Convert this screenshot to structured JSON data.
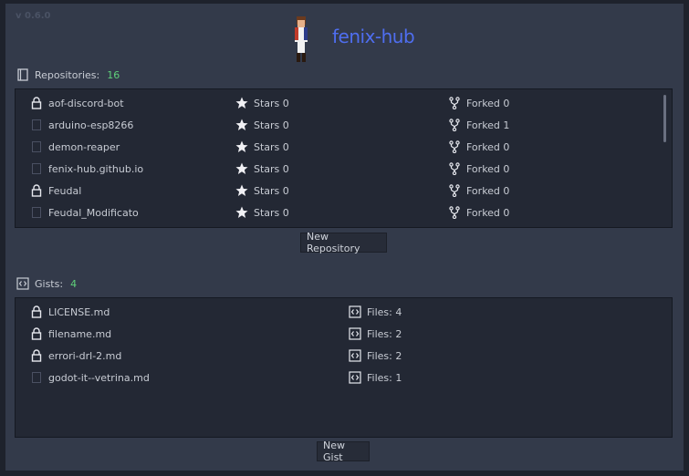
{
  "app": {
    "version": "v 0.6.0",
    "title": "fenix-hub"
  },
  "repositories": {
    "label": "Repositories:",
    "count": "16",
    "items": [
      {
        "name": "aof-discord-bot",
        "icon": "lock-icon",
        "stars": "Stars 0",
        "forks": "Forked 0"
      },
      {
        "name": "arduino-esp8266",
        "icon": "repo-icon",
        "stars": "Stars 0",
        "forks": "Forked 1"
      },
      {
        "name": "demon-reaper",
        "icon": "repo-icon",
        "stars": "Stars 0",
        "forks": "Forked 0"
      },
      {
        "name": "fenix-hub.github.io",
        "icon": "repo-icon",
        "stars": "Stars 0",
        "forks": "Forked 0"
      },
      {
        "name": "Feudal",
        "icon": "lock-icon",
        "stars": "Stars 0",
        "forks": "Forked 0"
      },
      {
        "name": "Feudal_Modificato",
        "icon": "repo-icon",
        "stars": "Stars 0",
        "forks": "Forked 0"
      }
    ],
    "new_button": "New Repository"
  },
  "gists": {
    "label": "Gists:",
    "count": "4",
    "items": [
      {
        "name": "LICENSE.md",
        "icon": "lock-icon",
        "files": "Files: 4"
      },
      {
        "name": "filename.md",
        "icon": "lock-icon",
        "files": "Files: 2"
      },
      {
        "name": "errori-drl-2.md",
        "icon": "lock-icon",
        "files": "Files: 2"
      },
      {
        "name": "godot-it--vetrina.md",
        "icon": "repo-icon",
        "files": "Files: 1"
      }
    ],
    "new_button": "New Gist"
  },
  "colors": {
    "accent": "#4f6ef0",
    "count": "#5fd07a",
    "background": "#333a4a",
    "panel": "#232834"
  }
}
